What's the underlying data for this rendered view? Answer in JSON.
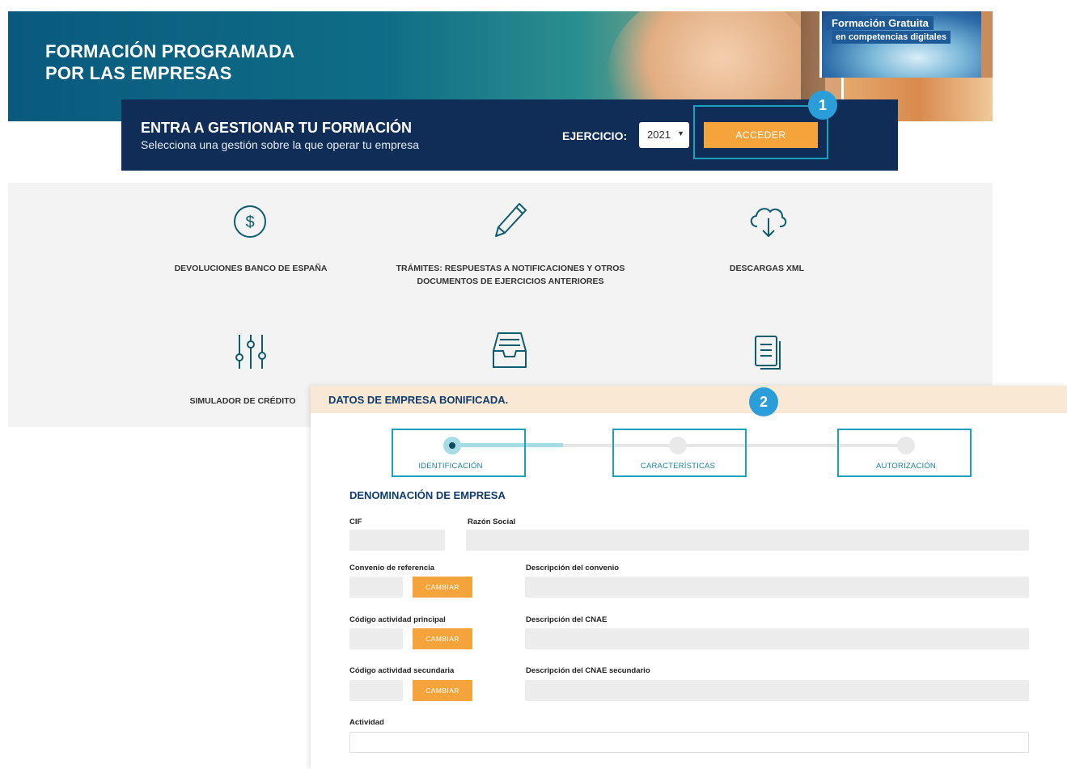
{
  "hero": {
    "title": "FORMACIÓN PROGRAMADA\nPOR LAS EMPRESAS",
    "promo_line1": "Formación Gratuita",
    "promo_line2": "en competencias digitales"
  },
  "access": {
    "title": "ENTRA A GESTIONAR TU FORMACIÓN",
    "subtitle": "Selecciona una gestión sobre la que operar tu empresa",
    "ejercicio_label": "EJERCICIO:",
    "year": "2021",
    "acceder_label": "ACCEDER"
  },
  "badges": {
    "one": "1",
    "two": "2"
  },
  "services": [
    {
      "icon": "dollar-circle-icon",
      "label": "DEVOLUCIONES BANCO DE ESPAÑA"
    },
    {
      "icon": "pencil-icon",
      "label": "TRÁMITES: RESPUESTAS A NOTIFICACIONES Y OTROS DOCUMENTOS DE EJERCICIOS ANTERIORES"
    },
    {
      "icon": "cloud-download-icon",
      "label": "DESCARGAS XML"
    },
    {
      "icon": "sliders-icon",
      "label": "SIMULADOR DE CRÉDITO"
    },
    {
      "icon": "inbox-tray-icon",
      "label": ""
    },
    {
      "icon": "document-icon",
      "label": ""
    }
  ],
  "form": {
    "title": "DATOS DE EMPRESA BONIFICADA.",
    "steps": [
      "IDENTIFICACIÓN",
      "CARACTERÍSTICAS",
      "AUTORIZACIÓN"
    ],
    "active_step": 0,
    "section_title": "DENOMINACIÓN DE EMPRESA",
    "fields": {
      "cif": "CIF",
      "razon_social": "Razón Social",
      "convenio": "Convenio de referencia",
      "desc_convenio": "Descripción del convenio",
      "actividad_principal": "Código actividad principal",
      "desc_cnae": "Descripción del CNAE",
      "actividad_secundaria": "Código actividad secundaria",
      "desc_cnae_sec": "Descripción del CNAE secundario",
      "actividad": "Actividad"
    },
    "cambiar_label": "CAMBIAR"
  },
  "colors": {
    "navy": "#0f2d56",
    "accent_orange": "#f5a43b",
    "highlight_teal": "#1ba1be",
    "badge_blue": "#2b9ed9"
  }
}
